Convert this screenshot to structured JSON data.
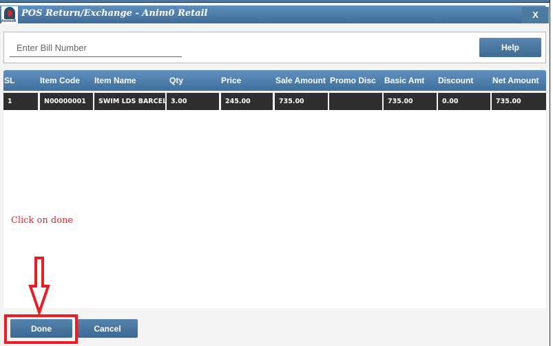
{
  "window": {
    "title": "POS Return/Exchange - Anim0 Retail",
    "logo_text": "AnimoR",
    "close_label": "X"
  },
  "search": {
    "placeholder": "Enter Bill Number",
    "value": "",
    "help_label": "Help"
  },
  "table": {
    "columns": [
      "SL",
      "Item Code",
      "Item Name",
      "Qty",
      "Price",
      "Sale Amount",
      "Promo Disc",
      "Basic Amt",
      "Discount",
      "Net Amount"
    ],
    "rows": [
      [
        "1",
        "N00000001",
        "SWIM LDS BARCEL",
        "3.00",
        "245.00",
        "735.00",
        "",
        "735.00",
        "0.00",
        "735.00"
      ]
    ]
  },
  "annotation": {
    "text": "Click on done"
  },
  "footer": {
    "done_label": "Done",
    "cancel_label": "Cancel"
  }
}
